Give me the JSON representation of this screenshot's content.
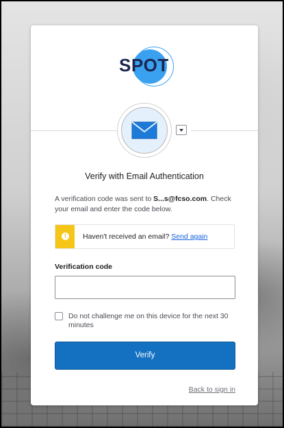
{
  "brand": {
    "logo_text": "SPOT",
    "accent_color": "#3aa1f0",
    "primary_button_color": "#1471c2"
  },
  "factor": {
    "icon": "mail-icon",
    "dropdown_icon": "chevron-down-icon"
  },
  "heading": "Verify with Email Authentication",
  "intro": {
    "prefix": "A verification code was sent to ",
    "email": "S...s@fcso.com",
    "suffix": ". Check your email and enter the code below."
  },
  "alert": {
    "icon": "warning-icon",
    "message": "Haven't received an email? ",
    "link": "Send again"
  },
  "form": {
    "code_label": "Verification code",
    "code_value": "",
    "remember_label": "Do not challenge me on this device for the next 30 minutes",
    "remember_checked": false,
    "submit_label": "Verify"
  },
  "footer": {
    "back_link": "Back to sign in"
  }
}
